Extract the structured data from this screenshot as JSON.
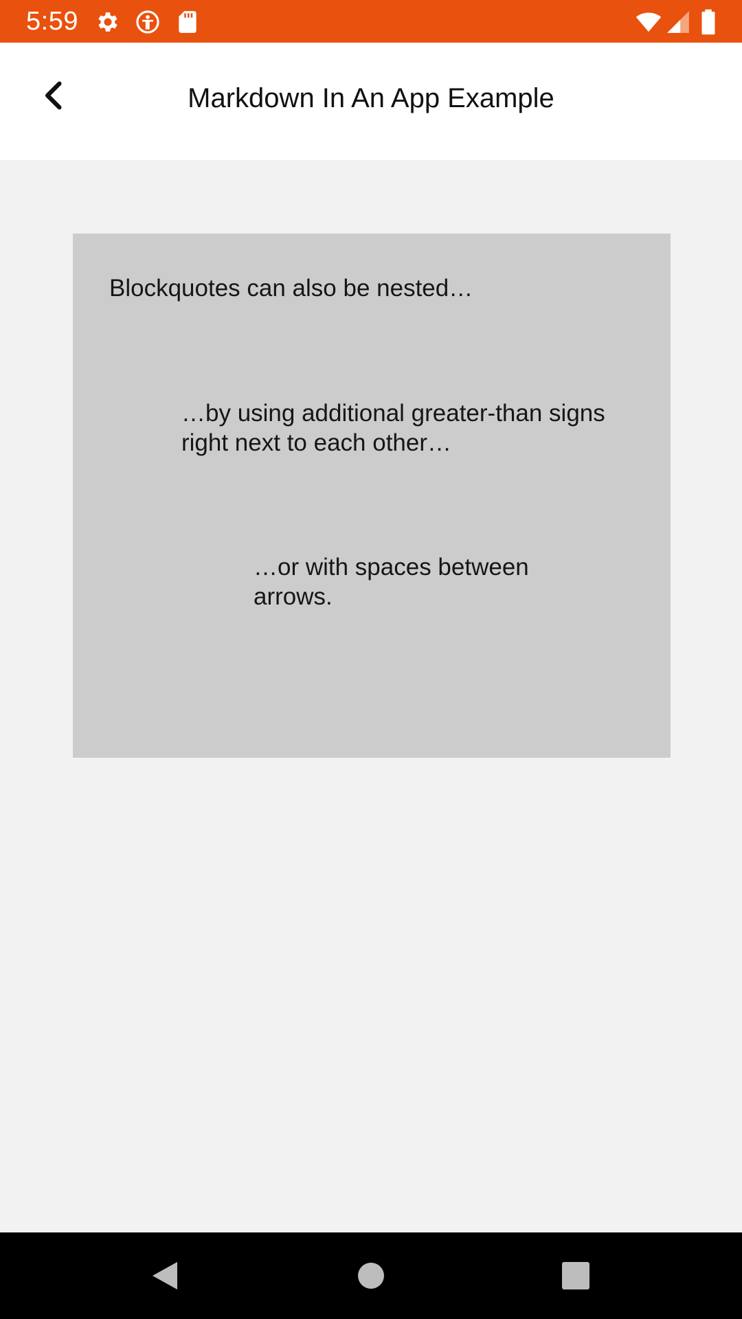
{
  "status_bar": {
    "time": "5:59",
    "background_color": "#e9510e",
    "left_icons": [
      "gear-icon",
      "accessibility-icon",
      "sd-card-icon"
    ],
    "right_icons": [
      "wifi-icon",
      "cell-signal-icon",
      "battery-icon"
    ]
  },
  "app_bar": {
    "title": "Markdown In An App Example",
    "back_icon": "chevron-left-icon"
  },
  "blockquote": {
    "background_color": "#cccccc",
    "level_1": "Blockquotes can also be nested…",
    "level_2": "…by using additional greater-than signs right next to each other…",
    "level_3": "…or with spaces between arrows."
  },
  "nav_bar": {
    "buttons": [
      "back-triangle-icon",
      "home-circle-icon",
      "recents-square-icon"
    ]
  }
}
